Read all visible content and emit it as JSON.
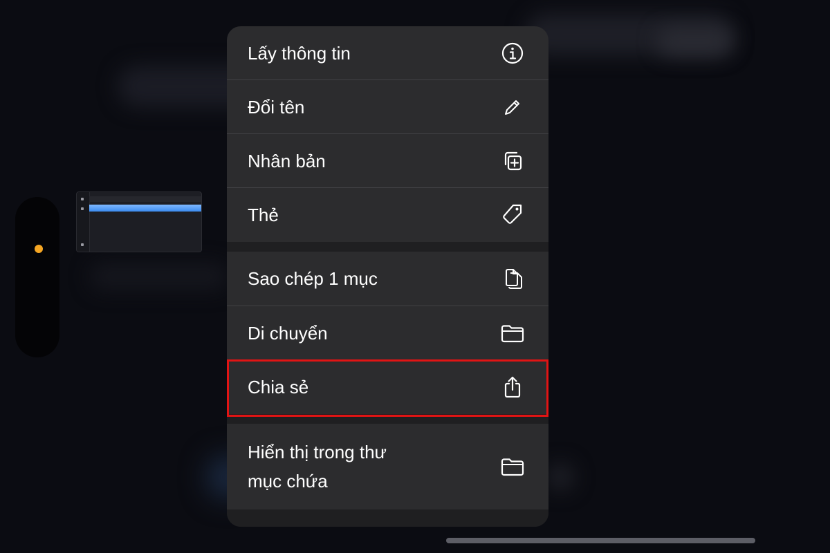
{
  "context_menu": {
    "items": [
      {
        "label": "Lấy thông tin",
        "icon": "info-circle-icon"
      },
      {
        "label": "Đổi tên",
        "icon": "pencil-icon"
      },
      {
        "label": "Nhân bản",
        "icon": "duplicate-icon"
      },
      {
        "label": "Thẻ",
        "icon": "tag-icon"
      },
      {
        "label": "Sao chép 1 mục",
        "icon": "copy-documents-icon"
      },
      {
        "label": "Di chuyển",
        "icon": "folder-icon"
      },
      {
        "label": "Chia sẻ",
        "icon": "share-icon"
      },
      {
        "label_line1": "Hiển thị trong thư",
        "label_line2": "mục chứa",
        "icon": "folder-icon"
      }
    ],
    "highlighted_item": "Chia sẻ"
  },
  "colors": {
    "menu_background": "#2c2c2e",
    "highlight_border": "#e11414",
    "status_dot": "#f5a623",
    "thumbnail_accent": "#3b8cf0"
  }
}
